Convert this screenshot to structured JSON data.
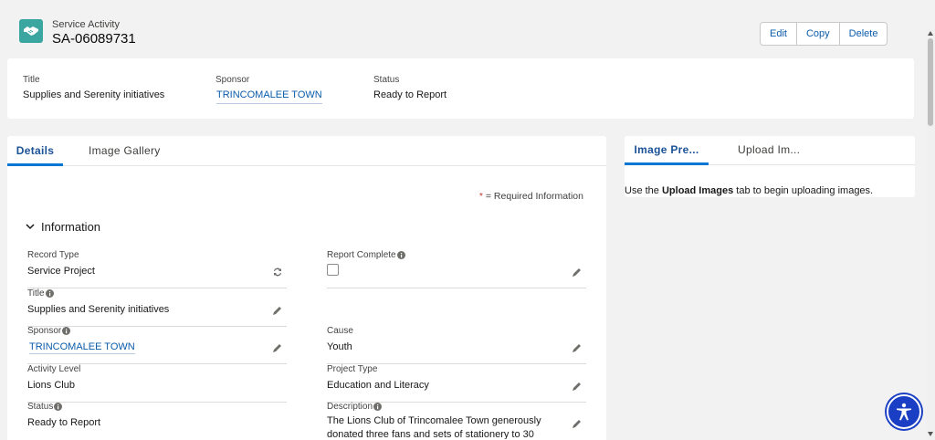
{
  "header": {
    "object_type": "Service Activity",
    "record_name": "SA-06089731",
    "buttons": {
      "edit": "Edit",
      "copy": "Copy",
      "delete": "Delete"
    }
  },
  "highlights": {
    "title": {
      "label": "Title",
      "value": "Supplies and Serenity initiatives"
    },
    "sponsor": {
      "label": "Sponsor",
      "value": "TRINCOMALEE TOWN"
    },
    "status": {
      "label": "Status",
      "value": "Ready to Report"
    }
  },
  "left_tabs": {
    "details": "Details",
    "gallery": "Image Gallery"
  },
  "required_note": {
    "star": "*",
    "text": " = Required Information"
  },
  "section_title": "Information",
  "fields": {
    "record_type": {
      "label": "Record Type",
      "value": "Service Project"
    },
    "report_complete": {
      "label": "Report Complete",
      "checked": false
    },
    "title": {
      "label": "Title",
      "value": "Supplies and Serenity initiatives"
    },
    "sponsor": {
      "label": "Sponsor",
      "value": "TRINCOMALEE TOWN"
    },
    "cause": {
      "label": "Cause",
      "value": "Youth"
    },
    "activity_level": {
      "label": "Activity Level",
      "value": "Lions Club"
    },
    "project_type": {
      "label": "Project Type",
      "value": "Education and Literacy"
    },
    "status": {
      "label": "Status",
      "value": "Ready to Report"
    },
    "description": {
      "label": "Description",
      "value": "The Lions Club of Trincomalee Town generously donated three fans and sets of stationery to 30"
    }
  },
  "right_tabs": {
    "preview": "Image Pre...",
    "upload": "Upload Im..."
  },
  "right_message": {
    "before": "Use the ",
    "bold": "Upload Images",
    "after": " tab to begin uploading images."
  },
  "colors": {
    "accent": "#0176d3",
    "link": "#0b5cab",
    "icon_bg": "#3ba5a0",
    "a11y": "#1a3fc4"
  }
}
